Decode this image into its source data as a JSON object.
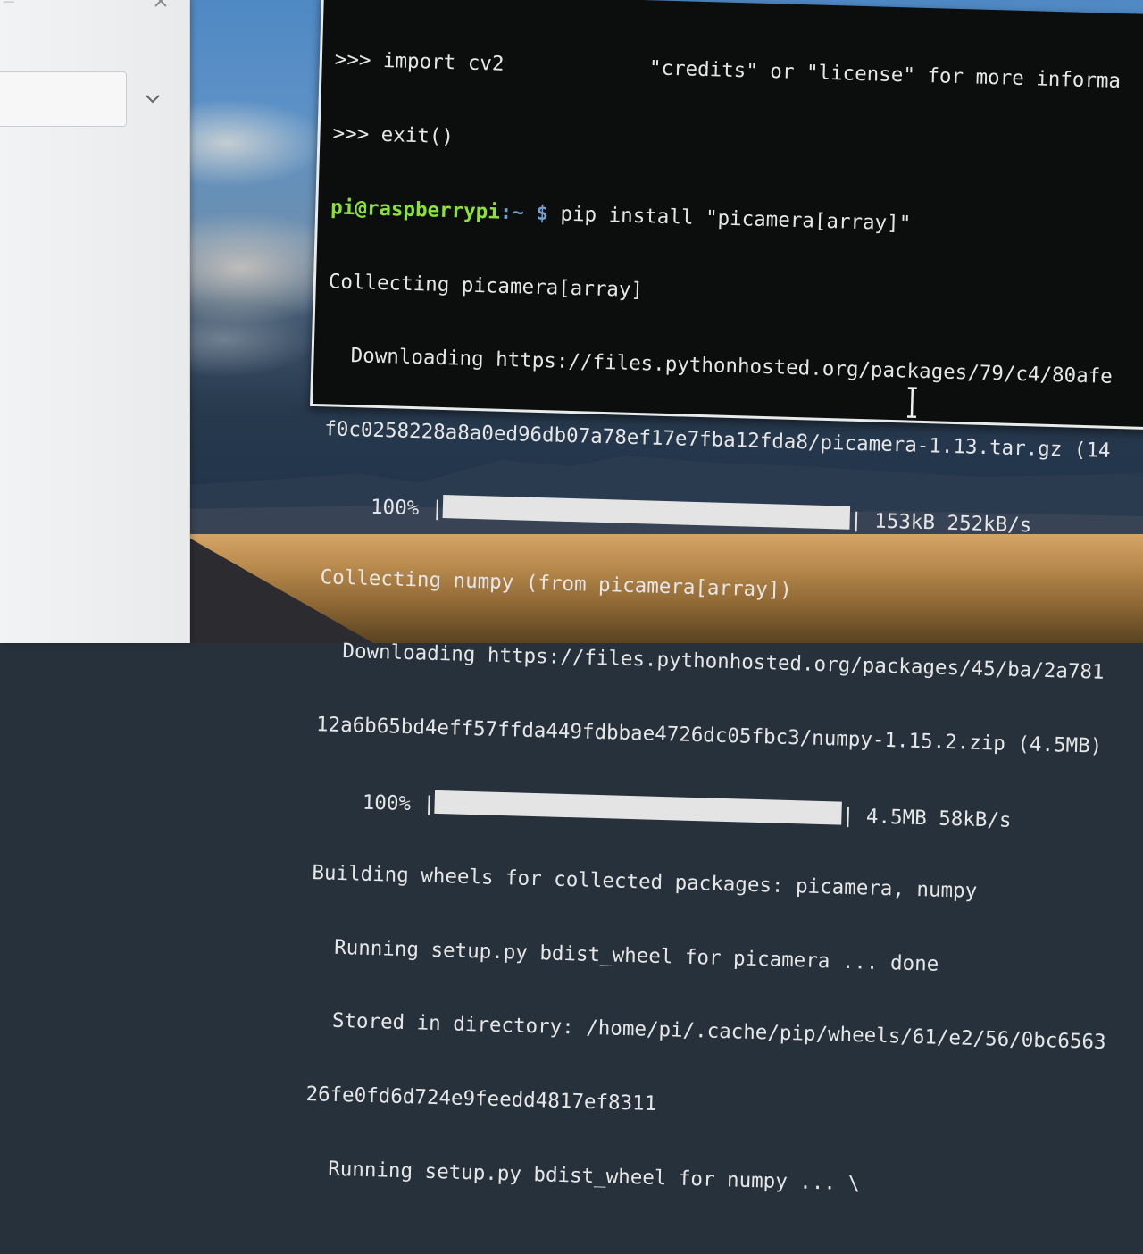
{
  "terminal": {
    "line0": ">>> import cv2",
    "line0_right": "\"credits\" or \"license\" for more informa",
    "line1": ">>> exit()",
    "prompt_user": "pi@raspberrypi",
    "prompt_path": ":~ $ ",
    "command": "pip install \"picamera[array]\"",
    "collect1": "Collecting picamera[array]",
    "download1": "  Downloading https://files.pythonhosted.org/packages/79/c4/80afe",
    "hash1": "f0c0258228a8a0ed96db07a78ef17e7fba12fda8/picamera-1.13.tar.gz (14",
    "progress1_pct": "    100% |",
    "progress1_end": "| 153kB 252kB/s",
    "progress1_fraction": 1.0,
    "collect2": "Collecting numpy (from picamera[array])",
    "download2": "  Downloading https://files.pythonhosted.org/packages/45/ba/2a781",
    "hash2": "12a6b65bd4eff57ffda449fdbbae4726dc05fbc3/numpy-1.15.2.zip (4.5MB)",
    "progress2_pct": "    100% |",
    "progress2_end": "| 4.5MB 58kB/s",
    "progress2_fraction": 1.0,
    "building": "Building wheels for collected packages: picamera, numpy",
    "running1": "  Running setup.py bdist_wheel for picamera ... done",
    "stored": "  Stored in directory: /home/pi/.cache/pip/wheels/61/e2/56/0bc6563",
    "hash3": "26fe0fd6d724e9feedd4817ef8311",
    "running2": "  Running setup.py bdist_wheel for numpy ... \\"
  },
  "left_panel": {
    "close_icon": "close-icon",
    "dropdown_icon": "chevron-down-icon"
  },
  "colors": {
    "terminal_bg": "#0c0d0d",
    "prompt_user": "#8ae234",
    "prompt_path": "#729fcf",
    "text": "#e6e6e6"
  }
}
